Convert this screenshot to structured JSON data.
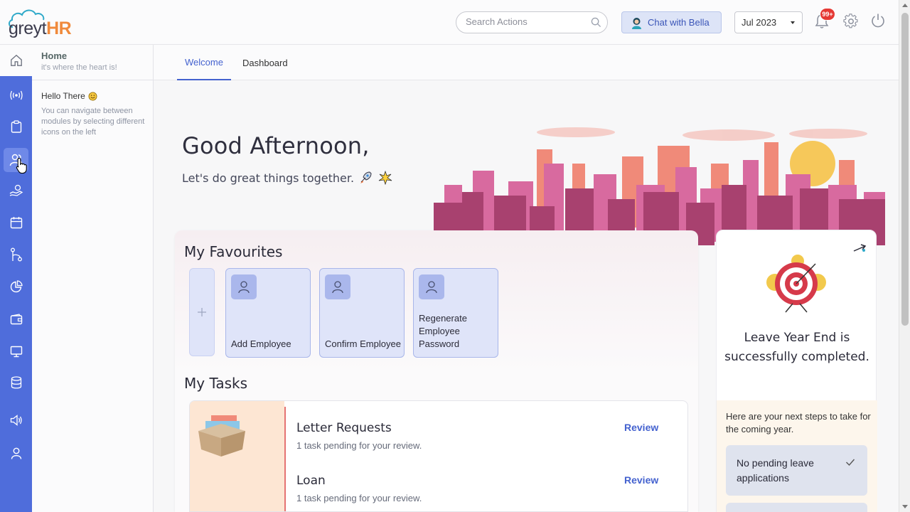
{
  "app": {
    "logo": {
      "grey": "greyt",
      "hr": "HR"
    }
  },
  "header": {
    "search_placeholder": "Search Actions",
    "chat_label": "Chat with Bella",
    "month_value": "Jul 2023",
    "notification_count": "99+"
  },
  "subpanel": {
    "title": "Home",
    "tagline": "it's where the heart is!",
    "hello": "Hello There",
    "hint": "You can navigate between modules by selecting different icons on the left"
  },
  "tabs": [
    {
      "label": "Welcome",
      "active": true
    },
    {
      "label": "Dashboard",
      "active": false
    }
  ],
  "hero": {
    "greeting": "Good Afternoon,",
    "subtitle": "Let's do great things together."
  },
  "favourites": {
    "title": "My Favourites",
    "items": [
      {
        "label": "Add Employee"
      },
      {
        "label": "Confirm Employee"
      },
      {
        "label": "Regenerate Employee Password"
      }
    ]
  },
  "tasks": {
    "title": "My Tasks",
    "items": [
      {
        "name": "Letter Requests",
        "sub": "1 task pending for your review.",
        "action": "Review"
      },
      {
        "name": "Loan",
        "sub": "1 task pending for your review.",
        "action": "Review"
      }
    ]
  },
  "leave_card": {
    "title": "Leave Year End is successfully completed.",
    "steps_intro": "Here are your next steps to take for the coming year.",
    "step1": "No pending leave applications"
  },
  "colors": {
    "rail": "#4f6ddb",
    "accent": "#4462cf",
    "brand_orange": "#f08a3c",
    "badge": "#e53935"
  }
}
